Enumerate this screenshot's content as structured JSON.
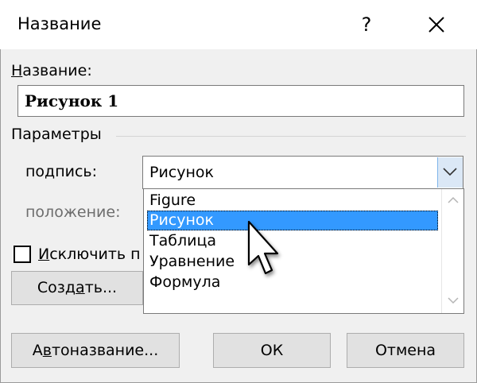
{
  "window": {
    "title": "Название",
    "help_glyph": "?",
    "close_icon": "close-icon"
  },
  "name_label": "азвание:",
  "name_label_mnemonic": "Н",
  "name_value": "Рисунок 1",
  "params_label": "Параметры",
  "caption_label_pre": "по",
  "caption_label_mnemonic": "д",
  "caption_label_post": "пись:",
  "caption_value": "Рисунок",
  "position_label": "положение:",
  "exclude_label_pre": "",
  "exclude_label_mnemonic": "И",
  "exclude_label_post": "сключить п",
  "create_button_pre": "Созд",
  "create_button_mnemonic": "а",
  "create_button_post": "ть...",
  "autoname_button_pre": "А",
  "autoname_button_mnemonic": "в",
  "autoname_button_post": "тоназвание...",
  "ok_button": "ОК",
  "cancel_button": "Отмена",
  "dropdown": {
    "options": [
      "Figure",
      "Рисунок",
      "Таблица",
      "Уравнение",
      "Формула"
    ],
    "selected_index": 1
  },
  "colors": {
    "selection": "#3399ff",
    "dialog_bg": "#f0f0f0",
    "combo_arrow_bg": "#dbe8f6"
  }
}
